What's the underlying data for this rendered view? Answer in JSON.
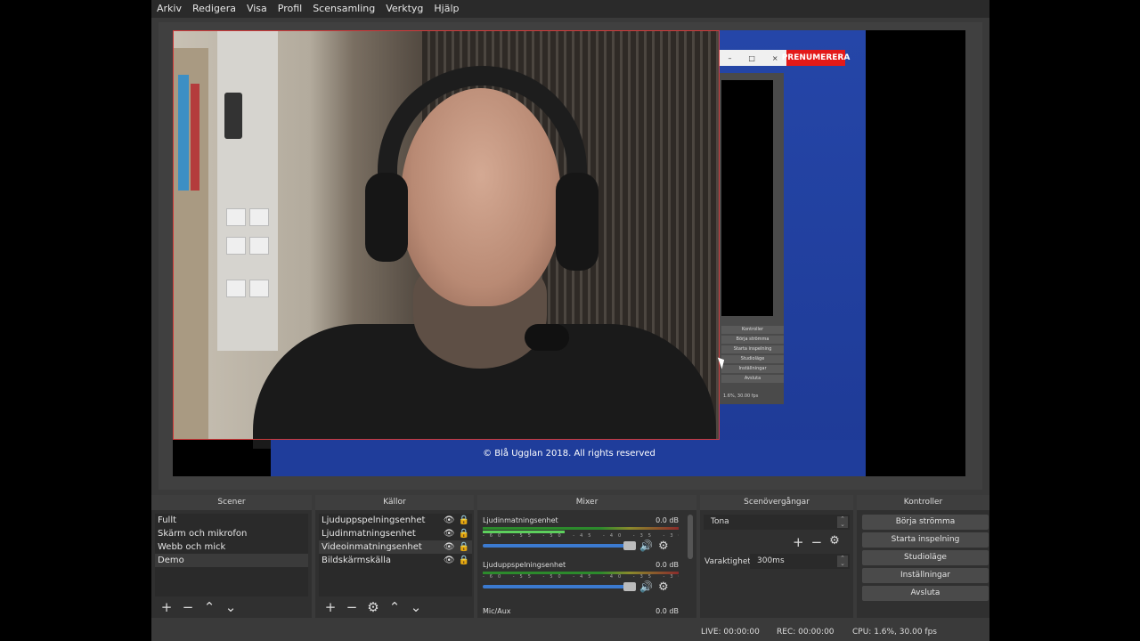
{
  "menu": [
    "Arkiv",
    "Redigera",
    "Visa",
    "Profil",
    "Scensamling",
    "Verktyg",
    "Hjälp"
  ],
  "preview": {
    "copyright": "© Blå Ugglan 2018. All rights reserved",
    "subscribe_label": "PRENUMERERA",
    "mini_window_controls": [
      "–",
      "□",
      "×"
    ],
    "mini_buttons": [
      "Kontroller",
      "Börja strömma",
      "Starta inspelning",
      "Studioläge",
      "Inställningar",
      "Avsluta"
    ],
    "mini_status": "1.6%, 30.00 fps"
  },
  "docks": {
    "scenes": {
      "title": "Scener",
      "items": [
        "Fullt",
        "Skärm och mikrofon",
        "Webb och mick",
        "Demo"
      ],
      "selected_index": 3
    },
    "sources": {
      "title": "Källor",
      "items": [
        "Ljuduppspelningsenhet",
        "Ljudinmatningsenhet",
        "Videoinmatningsenhet",
        "Bildskärmskälla"
      ],
      "selected_index": 2
    },
    "mixer": {
      "title": "Mixer",
      "channels": [
        {
          "name": "Ljudinmatningsenhet",
          "db": "0.0 dB",
          "level": 0.42
        },
        {
          "name": "Ljuduppspelningsenhet",
          "db": "0.0 dB",
          "level": 0.0
        },
        {
          "name": "Mic/Aux",
          "db": "0.0 dB",
          "level": 0.0
        }
      ],
      "ticks": "-60 -55 -50 -45 -40 -35 -30 -25 -20 -15 -10 -5 0"
    },
    "transitions": {
      "title": "Scenövergångar",
      "transition": "Tona",
      "duration_label": "Varaktighet",
      "duration_value": "300ms"
    },
    "controls": {
      "title": "Kontroller",
      "buttons": [
        "Börja strömma",
        "Starta inspelning",
        "Studioläge",
        "Inställningar",
        "Avsluta"
      ]
    }
  },
  "status": {
    "live": "LIVE: 00:00:00",
    "rec": "REC: 00:00:00",
    "cpu": "CPU: 1.6%, 30.00 fps"
  },
  "colors": {
    "accent_blue": "#3b7ad0",
    "selection_red": "#d23b3b",
    "subscribe_red": "#e31919"
  }
}
